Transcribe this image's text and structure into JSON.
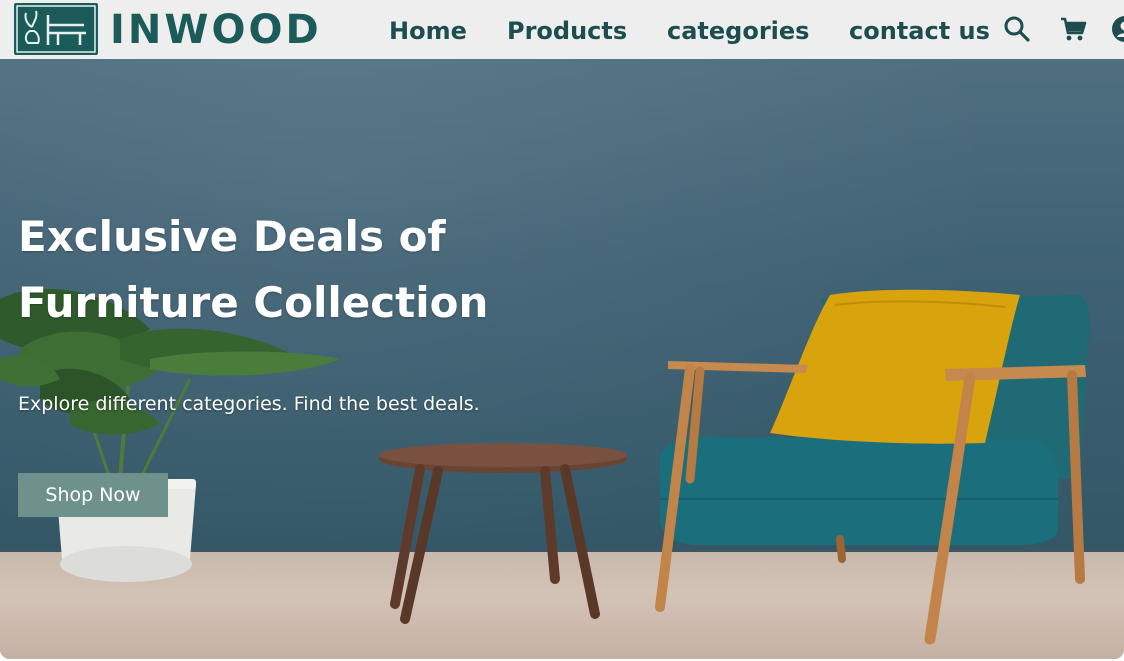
{
  "brand": {
    "name": "INWOOD",
    "accent_color": "#1b5b5a"
  },
  "nav": {
    "items": [
      {
        "label": "Home"
      },
      {
        "label": "Products"
      },
      {
        "label": "categories"
      },
      {
        "label": "contact us"
      }
    ],
    "icons": [
      "search-icon",
      "cart-icon",
      "user-icon"
    ]
  },
  "hero": {
    "title_line1": "Exclusive Deals of",
    "title_line2": "Furniture Collection",
    "subtitle": "Explore different categories. Find the best deals.",
    "cta_label": "Shop Now",
    "cta_color": "#6e918b"
  }
}
